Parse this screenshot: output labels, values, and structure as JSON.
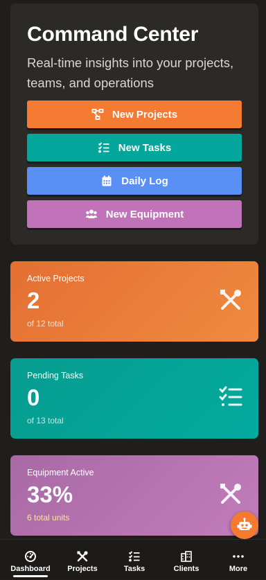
{
  "hero": {
    "title": "Command Center",
    "subtitle": "Real-time insights into your projects, teams, and operations"
  },
  "actions": [
    {
      "label": "New Projects",
      "icon": "diagram-icon",
      "color": "#f57a32"
    },
    {
      "label": "New Tasks",
      "icon": "checklist-icon",
      "color": "#03a69a"
    },
    {
      "label": "Daily Log",
      "icon": "calendar-icon",
      "color": "#5a90f5"
    },
    {
      "label": "New Equipment",
      "icon": "users-icon",
      "color": "#c073b8"
    }
  ],
  "stats": [
    {
      "label": "Active Projects",
      "value": "2",
      "sub": "of 12 total",
      "icon": "tools-icon",
      "color": "#e8763a",
      "sub_color": "#fde3cf"
    },
    {
      "label": "Pending Tasks",
      "value": "0",
      "sub": "of 13 total",
      "icon": "checklist-icon",
      "color": "#03a69a",
      "sub_color": "#b7f0e6"
    },
    {
      "label": "Equipment Active",
      "value": "33%",
      "sub": "6 total units",
      "icon": "tools-icon",
      "color": "#b472ad",
      "sub_color": "#ffe2a3"
    }
  ],
  "assistant": {
    "icon": "robot-icon"
  },
  "nav": [
    {
      "label": "Dashboard",
      "icon": "gauge-icon",
      "active": true
    },
    {
      "label": "Projects",
      "icon": "tools-icon",
      "active": false
    },
    {
      "label": "Tasks",
      "icon": "checklist-icon",
      "active": false
    },
    {
      "label": "Clients",
      "icon": "building-icon",
      "active": false
    },
    {
      "label": "More",
      "icon": "dots-icon",
      "active": false
    }
  ]
}
